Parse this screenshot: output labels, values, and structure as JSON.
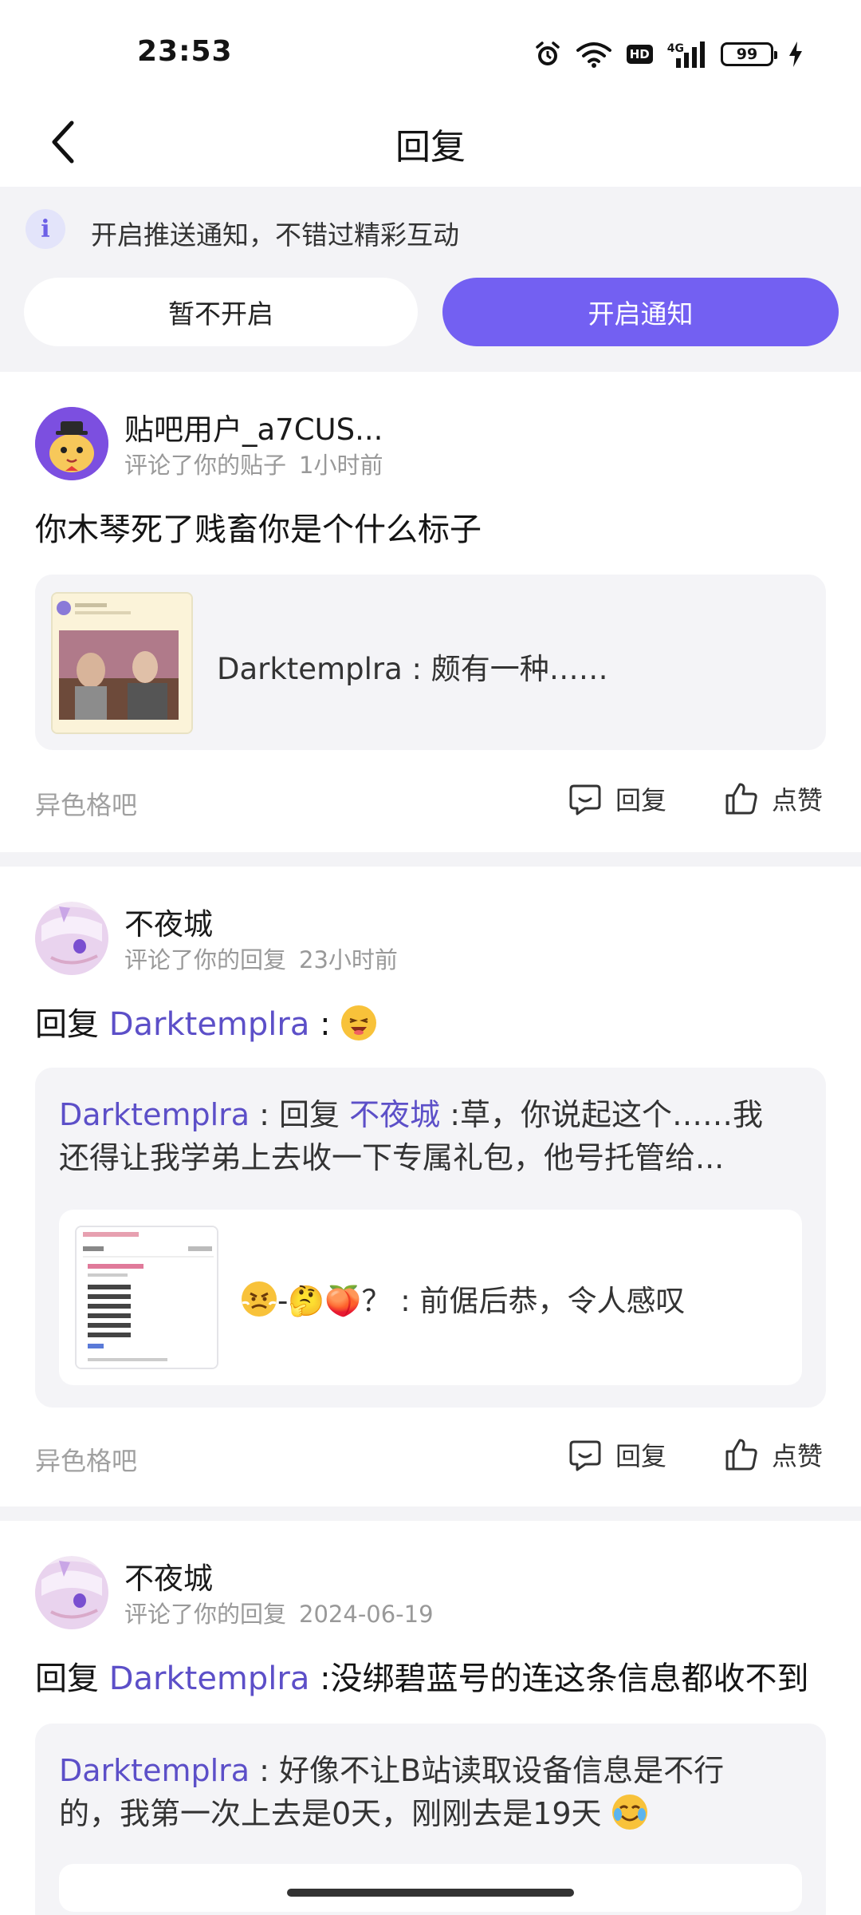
{
  "status_bar": {
    "time": "23:53",
    "network": "4G",
    "hd": "HD",
    "battery": "99",
    "icons": [
      "alarm-icon",
      "wifi-icon",
      "hd-icon",
      "signal-icon",
      "battery-icon",
      "charging-icon"
    ]
  },
  "header": {
    "title": "回复",
    "back_icon": "chevron-left-icon"
  },
  "notification": {
    "info_icon": "i",
    "text": "开启推送通知，不错过精彩互动",
    "later_label": "暂不开启",
    "enable_label": "开启通知",
    "accent": "#7360f2"
  },
  "replies": [
    {
      "user": "贴吧用户_a7CUS...",
      "action": "评论了你的贴子",
      "time": "1小时前",
      "content": "你木琴死了贱畜你是个什么标子",
      "quote": {
        "author": "Darktemplra",
        "sep": " : ",
        "text": "颇有一种……"
      },
      "forum": "异色格吧",
      "reply_label": "回复",
      "like_label": "点赞"
    },
    {
      "user": "不夜城",
      "action": "评论了你的回复",
      "time": "23小时前",
      "content_prefix": "回复",
      "content_mention": "Darktemplra",
      "content_suffix": " :",
      "quote": {
        "author": "Darktemplra",
        "sep": " : ",
        "reply_word": "回复",
        "mention": "不夜城",
        "line1_rest": " :草，你说起这个……我",
        "line2": "还得让我学弟上去收一下专属礼包，他号托管给..."
      },
      "inner": {
        "text": "-🤔🍑？ : 前倨后恭，令人感叹"
      },
      "forum": "异色格吧",
      "reply_label": "回复",
      "like_label": "点赞"
    },
    {
      "user": "不夜城",
      "action": "评论了你的回复",
      "time": "2024-06-19",
      "content_prefix": "回复",
      "content_mention": "Darktemplra",
      "content_suffix": " :没绑碧蓝号的连这条信息都收不到",
      "quote": {
        "author": "Darktemplra",
        "sep": " : ",
        "line1_rest": "好像不让B站读取设备信息是不行",
        "line2": "的，我第一次上去是0天，刚刚去是19天"
      }
    }
  ]
}
